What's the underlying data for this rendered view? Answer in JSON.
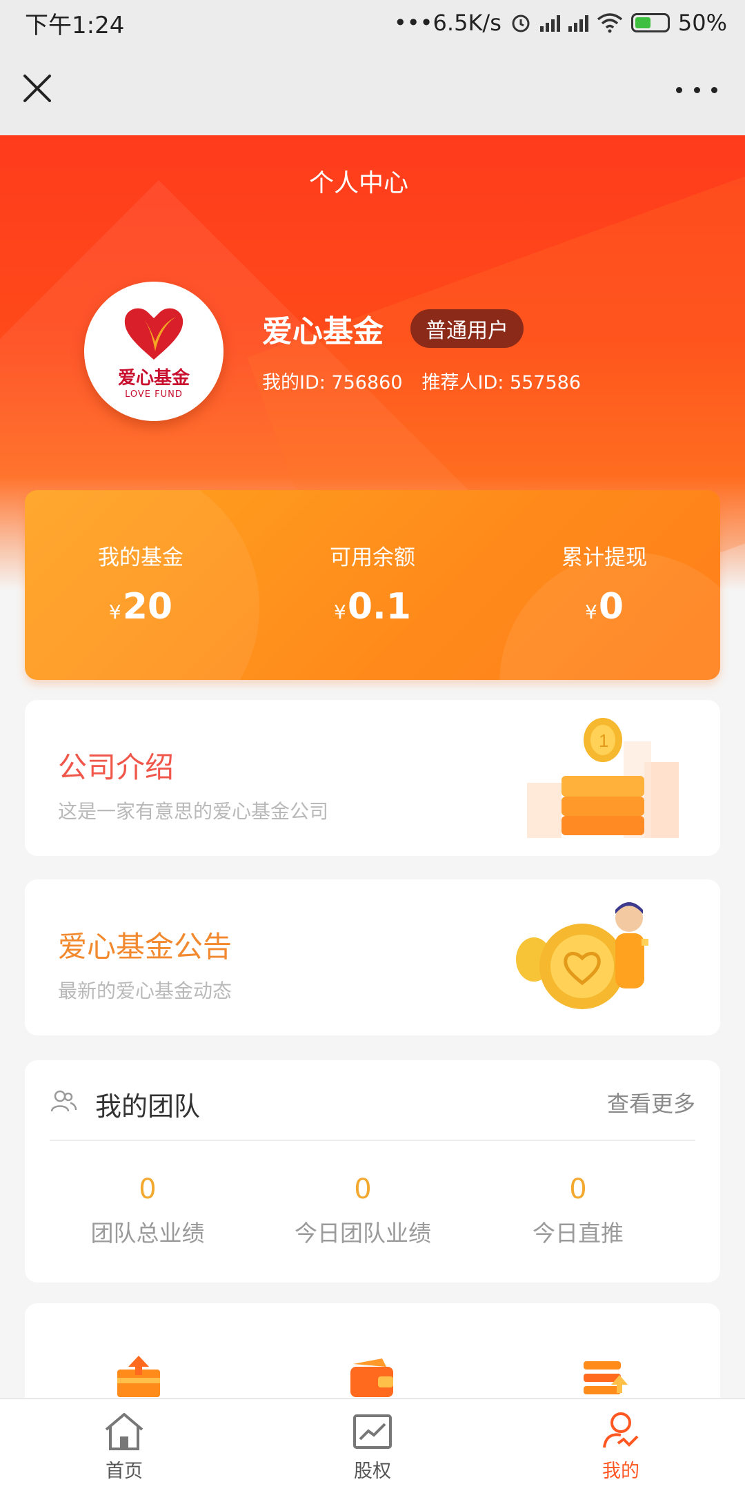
{
  "status": {
    "time": "下午1:24",
    "network_speed": "•••6.5K/s",
    "battery": "50%",
    "icons": [
      "alarm-icon",
      "signal-icon",
      "hd-signal-icon",
      "wifi-icon",
      "battery-charging-icon"
    ]
  },
  "nav": {
    "close_icon": "close-icon",
    "more_icon": "more-horizontal-icon"
  },
  "header": {
    "title": "个人中心"
  },
  "profile": {
    "avatar": {
      "logo_cn": "爱心基金",
      "logo_en": "LOVE FUND"
    },
    "name": "爱心基金",
    "badge": "普通用户",
    "my_id": "我的ID: 756860",
    "referrer_id": "推荐人ID: 557586"
  },
  "stats": [
    {
      "label": "我的基金",
      "currency": "¥",
      "value": "20"
    },
    {
      "label": "可用余额",
      "currency": "¥",
      "value": "0.1"
    },
    {
      "label": "累计提现",
      "currency": "¥",
      "value": "0"
    }
  ],
  "cards": {
    "company": {
      "title": "公司介绍",
      "subtitle": "这是一家有意思的爱心基金公司",
      "title_color": "#f0574a",
      "illustration": "coin-stack-illustration"
    },
    "notice": {
      "title": "爱心基金公告",
      "subtitle": "最新的爱心基金动态",
      "title_color": "#f2892f",
      "illustration": "person-holding-heart-coin-illustration"
    }
  },
  "team": {
    "icon": "team-icon",
    "title": "我的团队",
    "more": "查看更多",
    "stats": [
      {
        "value": "0",
        "label": "团队总业绩"
      },
      {
        "value": "0",
        "label": "今日团队业绩"
      },
      {
        "value": "0",
        "label": "今日直推"
      }
    ]
  },
  "menu_icons": [
    "upload-card-icon",
    "wallet-icon",
    "stack-upload-icon"
  ],
  "tabbar": [
    {
      "label": "首页",
      "icon": "home-icon",
      "active": false
    },
    {
      "label": "股权",
      "icon": "chart-icon",
      "active": false
    },
    {
      "label": "我的",
      "icon": "user-icon",
      "active": true
    }
  ],
  "colors": {
    "accent": "#ff5722",
    "header": "#ff3b1c",
    "stats_card": "#ff9a1e",
    "value_yellow": "#f3a92f"
  }
}
